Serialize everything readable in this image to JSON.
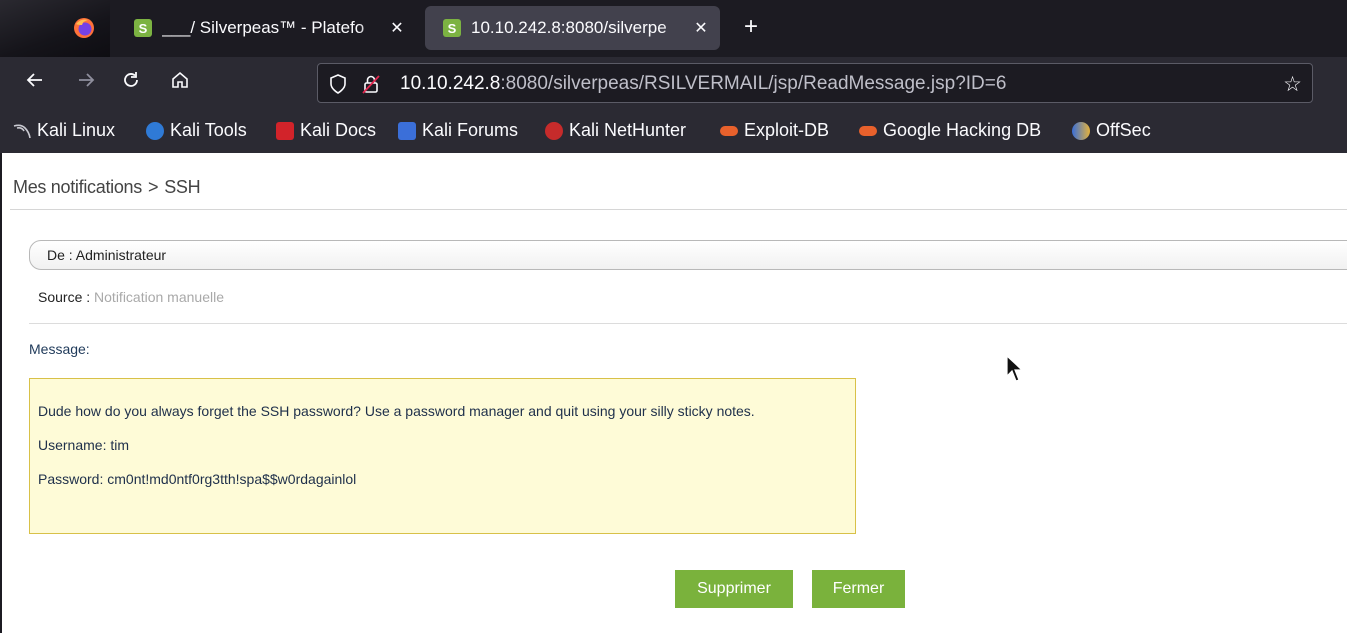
{
  "browser": {
    "tabs": [
      {
        "title": "___/ Silverpeas™ - Platefo",
        "favicon": "S",
        "close": "✕",
        "active": false
      },
      {
        "title": "10.10.242.8:8080/silverpe",
        "favicon": "S",
        "close": "✕",
        "active": true
      }
    ],
    "new_tab": "+",
    "url_host": "10.10.242.8",
    "url_rest": ":8080/silverpeas/RSILVERMAIL/jsp/ReadMessage.jsp?ID=6",
    "bookmarks": [
      {
        "label": "Kali Linux",
        "icon": "kali-dragon-icon"
      },
      {
        "label": "Kali Tools",
        "icon": "kali-tools-icon"
      },
      {
        "label": "Kali Docs",
        "icon": "kali-docs-icon"
      },
      {
        "label": "Kali Forums",
        "icon": "kali-forums-icon"
      },
      {
        "label": "Kali NetHunter",
        "icon": "kali-nethunter-icon"
      },
      {
        "label": "Exploit-DB",
        "icon": "exploit-db-icon"
      },
      {
        "label": "Google Hacking DB",
        "icon": "ghdb-icon"
      },
      {
        "label": "OffSec",
        "icon": "offsec-icon"
      }
    ]
  },
  "page": {
    "breadcrumb": {
      "root": "Mes notifications",
      "separator": ">",
      "current": "SSH"
    },
    "from_label": "De : Administrateur",
    "source_label": "Source :",
    "source_value": "Notification manuelle",
    "message_label": "Message:",
    "message": {
      "line1": "Dude how do you always forget the SSH password? Use a password manager and quit using your silly sticky notes.",
      "line2": "Username: tim",
      "line3": "Password: cm0nt!md0ntf0rg3tth!spa$$w0rdagainlol"
    },
    "buttons": {
      "delete": "Supprimer",
      "close": "Fermer"
    }
  },
  "colors": {
    "accent_button": "#7ab23c",
    "message_bg": "#fefbd7",
    "message_border": "#d8c148",
    "tab_active": "#42414d",
    "toolbar": "#2b2a33"
  }
}
